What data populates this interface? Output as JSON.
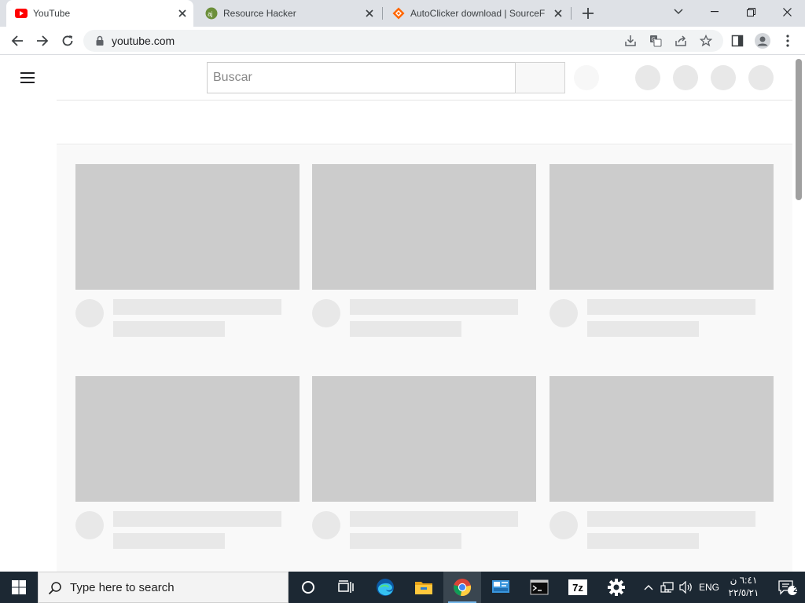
{
  "browser": {
    "tabs": [
      {
        "title": "YouTube",
        "favicon": "youtube-icon",
        "active": true
      },
      {
        "title": "Resource Hacker",
        "favicon": "resource-hacker-icon",
        "active": false
      },
      {
        "title": "AutoClicker download | SourceF",
        "favicon": "sourceforge-icon",
        "active": false
      }
    ],
    "address": "youtube.com",
    "accent": "#dee1e6"
  },
  "youtube": {
    "search_placeholder": "Buscar",
    "brand_color": "#ff0000",
    "grid_rows": 2,
    "grid_cols": 3
  },
  "taskbar": {
    "search_placeholder": "Type here to search",
    "apps": [
      "task-view-icon",
      "edge-icon",
      "file-explorer-icon",
      "chrome-icon",
      "control-panel-icon",
      "terminal-icon",
      "7zip-icon",
      "settings-icon"
    ],
    "language": "ENG",
    "app_7zip_label": "7z",
    "clock_time": "٦:٤١ ن",
    "clock_date": "٢٢/٥/٢١",
    "notification_count": "2",
    "background": "#1c2833"
  }
}
